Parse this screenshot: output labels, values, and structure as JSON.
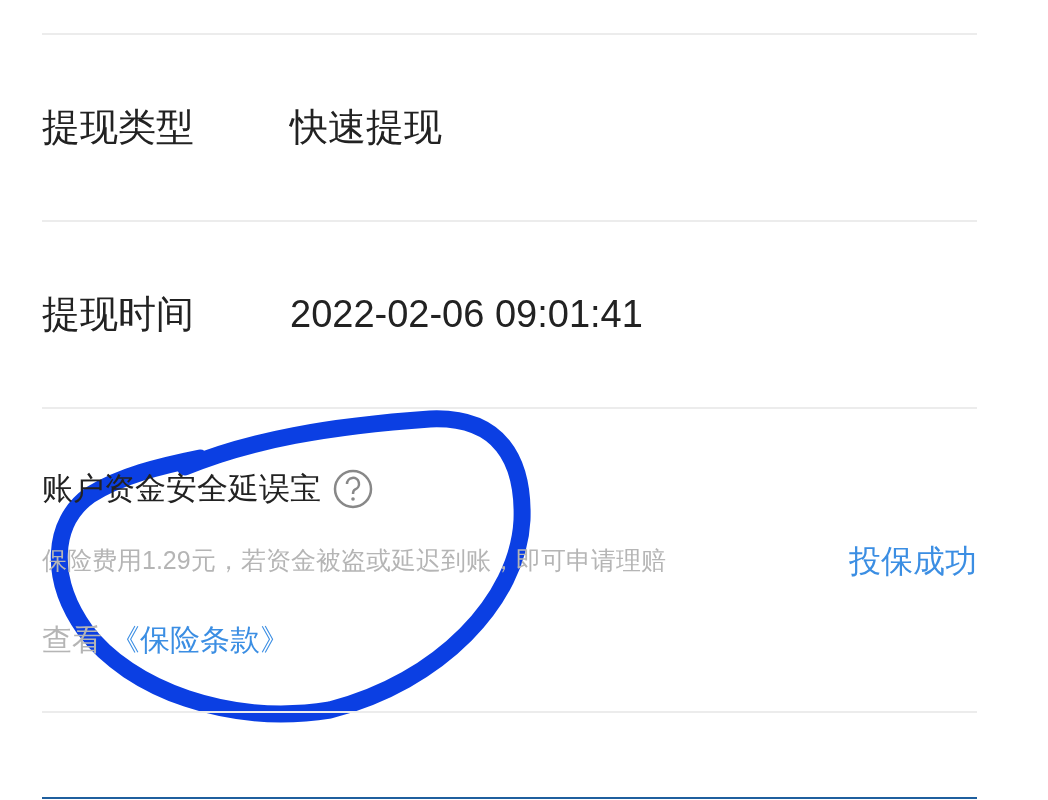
{
  "rows": [
    {
      "label": "提现类型",
      "value": "快速提现"
    },
    {
      "label": "提现时间",
      "value": "2022-02-06 09:01:41"
    }
  ],
  "insurance": {
    "title": "账户资金安全延误宝",
    "description": "保险费用1.29元，若资金被盗或延迟到账，即可申请理赔",
    "status": "投保成功",
    "view_prefix": "查看",
    "terms_link": "《保险条款》"
  }
}
